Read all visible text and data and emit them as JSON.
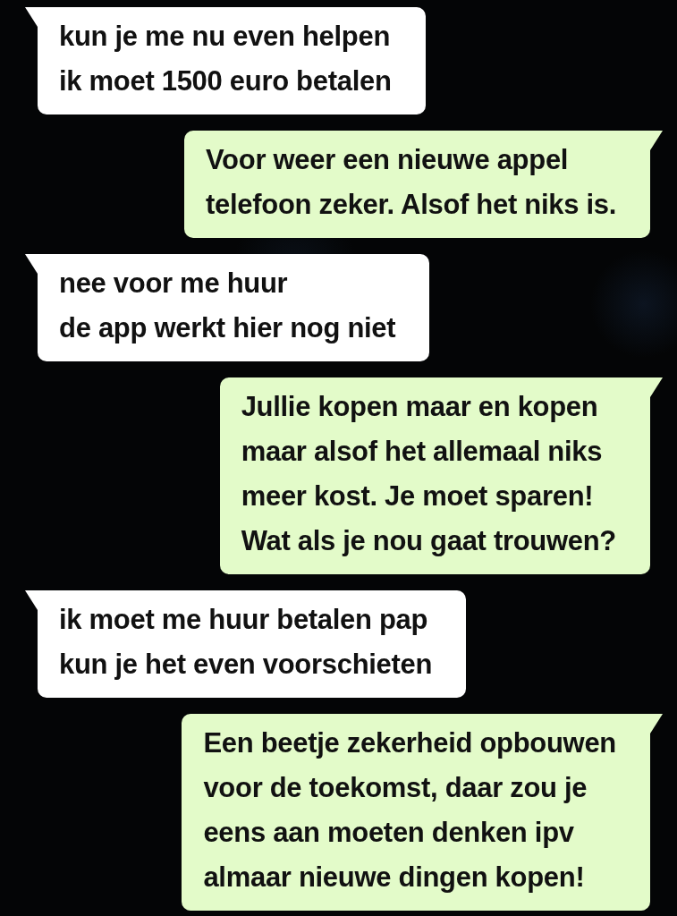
{
  "messages": [
    {
      "kind": "incoming",
      "text": "kun je me nu even helpen\nik moet 1500 euro betalen"
    },
    {
      "kind": "outgoing",
      "text": "Voor weer een nieuwe appel\ntelefoon zeker. Alsof het niks is."
    },
    {
      "kind": "incoming",
      "text": "nee voor me huur\nde app werkt hier nog niet"
    },
    {
      "kind": "outgoing",
      "text": "Jullie kopen maar en kopen\nmaar alsof het allemaal niks\nmeer kost. Je moet sparen!\nWat als je nou gaat trouwen?"
    },
    {
      "kind": "incoming",
      "text": "ik moet me huur betalen pap\nkun je het even voorschieten"
    },
    {
      "kind": "outgoing",
      "text": "Een beetje zekerheid opbouwen\nvoor de toekomst, daar zou je\neens aan moeten denken ipv\nalmaar nieuwe dingen kopen!"
    }
  ]
}
